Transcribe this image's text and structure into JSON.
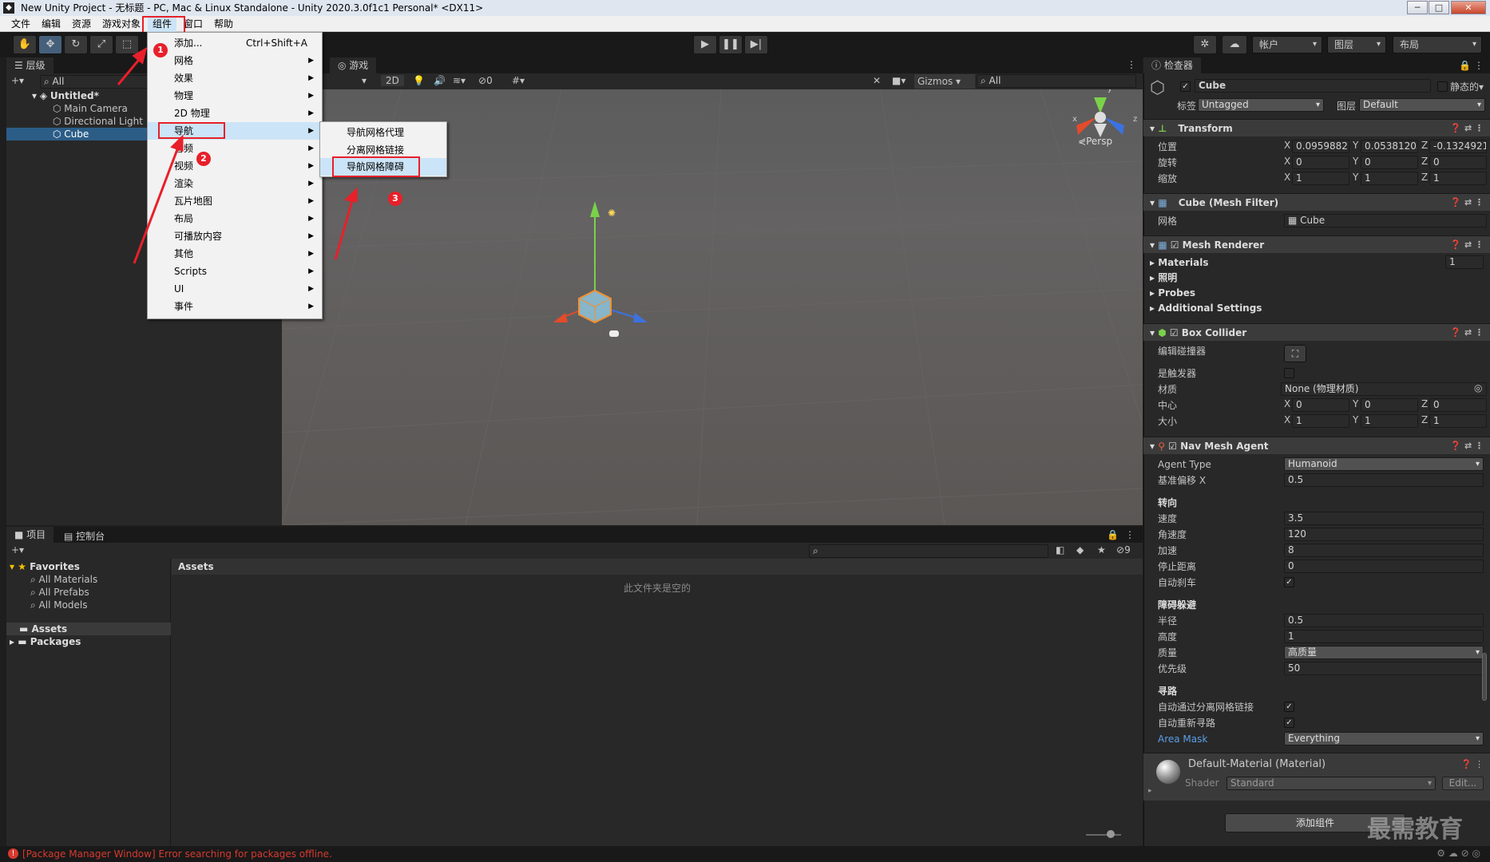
{
  "window": {
    "title": "New Unity Project - 无标题 - PC, Mac & Linux Standalone - Unity 2020.3.0f1c1 Personal* <DX11>",
    "min": "─",
    "max": "□",
    "close": "✕"
  },
  "menubar": [
    "文件",
    "编辑",
    "资源",
    "游戏对象",
    "组件",
    "窗口",
    "帮助"
  ],
  "toolbar": {
    "account": "帐户",
    "layers": "图层",
    "layout": "布局"
  },
  "hierarchy": {
    "tab": "层级",
    "search": "All",
    "scene": "Untitled*",
    "objects": [
      "Main Camera",
      "Directional Light",
      "Cube"
    ]
  },
  "scene": {
    "tab": "游戏",
    "mode2d": "2D",
    "hidden_count": "0",
    "gizmos": "Gizmos",
    "search": "All",
    "persp": "Persp",
    "gizmo_y": "y",
    "gizmo_x": "x",
    "gizmo_z": "z"
  },
  "component_menu": {
    "items": [
      {
        "label": "添加...",
        "shortcut": "Ctrl+Shift+A"
      },
      {
        "label": "网格"
      },
      {
        "label": "效果"
      },
      {
        "label": "物理"
      },
      {
        "label": "2D 物理"
      },
      {
        "label": "导航"
      },
      {
        "label": "音频"
      },
      {
        "label": "视频"
      },
      {
        "label": "渲染"
      },
      {
        "label": "瓦片地图"
      },
      {
        "label": "布局"
      },
      {
        "label": "可播放内容"
      },
      {
        "label": "其他"
      },
      {
        "label": "Scripts"
      },
      {
        "label": "UI"
      },
      {
        "label": "事件"
      }
    ]
  },
  "nav_submenu": {
    "items": [
      "导航网格代理",
      "分离网格链接",
      "导航网格障碍"
    ]
  },
  "annotations": [
    "1",
    "2",
    "3"
  ],
  "project": {
    "tab_project": "项目",
    "tab_console": "控制台",
    "favorites": "Favorites",
    "fav_items": [
      "All Materials",
      "All Prefabs",
      "All Models"
    ],
    "assets": "Assets",
    "packages": "Packages",
    "breadcrumb": "Assets",
    "empty": "此文件夹是空的",
    "hidden_count": "9"
  },
  "inspector": {
    "tab": "检查器",
    "name": "Cube",
    "static": "静态的",
    "tag_label": "标签",
    "tag": "Untagged",
    "layer_label": "图层",
    "layer": "Default",
    "transform": {
      "title": "Transform",
      "rows": [
        {
          "label": "位置",
          "x": "0.09598827",
          "y": "0.05381203",
          "z": "-0.1324921"
        },
        {
          "label": "旋转",
          "x": "0",
          "y": "0",
          "z": "0"
        },
        {
          "label": "缩放",
          "x": "1",
          "y": "1",
          "z": "1"
        }
      ]
    },
    "mesh_filter": {
      "title": "Cube (Mesh Filter)",
      "label": "网格",
      "value": "Cube"
    },
    "mesh_renderer": {
      "title": "Mesh Renderer",
      "sections": [
        "Materials",
        "照明",
        "Probes",
        "Additional Settings"
      ],
      "materials_count": "1"
    },
    "box_collider": {
      "title": "Box Collider",
      "edit": "编辑碰撞器",
      "trigger": "是触发器",
      "material_label": "材质",
      "material": "None (物理材质)",
      "center": {
        "label": "中心",
        "x": "0",
        "y": "0",
        "z": "0"
      },
      "size": {
        "label": "大小",
        "x": "1",
        "y": "1",
        "z": "1"
      }
    },
    "nav_agent": {
      "title": "Nav Mesh Agent",
      "agent_type_label": "Agent Type",
      "agent_type": "Humanoid",
      "base_offset_label": "基准偏移 X",
      "base_offset": "0.5",
      "steering": "转向",
      "speed_label": "速度",
      "speed": "3.5",
      "angular_label": "角速度",
      "angular": "120",
      "accel_label": "加速",
      "accel": "8",
      "stop_label": "停止距离",
      "stop": "0",
      "brake_label": "自动刹车",
      "avoid": "障碍躲避",
      "radius_label": "半径",
      "radius": "0.5",
      "height_label": "高度",
      "height": "1",
      "quality_label": "质量",
      "quality": "高质量",
      "priority_label": "优先级",
      "priority": "50",
      "path": "寻路",
      "traverse_label": "自动通过分离网格链接",
      "repath_label": "自动重新寻路",
      "area_label": "Area Mask",
      "area": "Everything"
    },
    "material": {
      "name": "Default-Material (Material)",
      "shader_label": "Shader",
      "shader": "Standard",
      "edit": "Edit..."
    },
    "add_component": "添加组件"
  },
  "watermark": "最需教育",
  "status": {
    "error": "[Package Manager Window] Error searching for packages offline."
  },
  "axes": {
    "X": "X",
    "Y": "Y",
    "Z": "Z"
  },
  "colors": {
    "accent": "#2c5d87",
    "annotation_red": "#e8202a"
  }
}
